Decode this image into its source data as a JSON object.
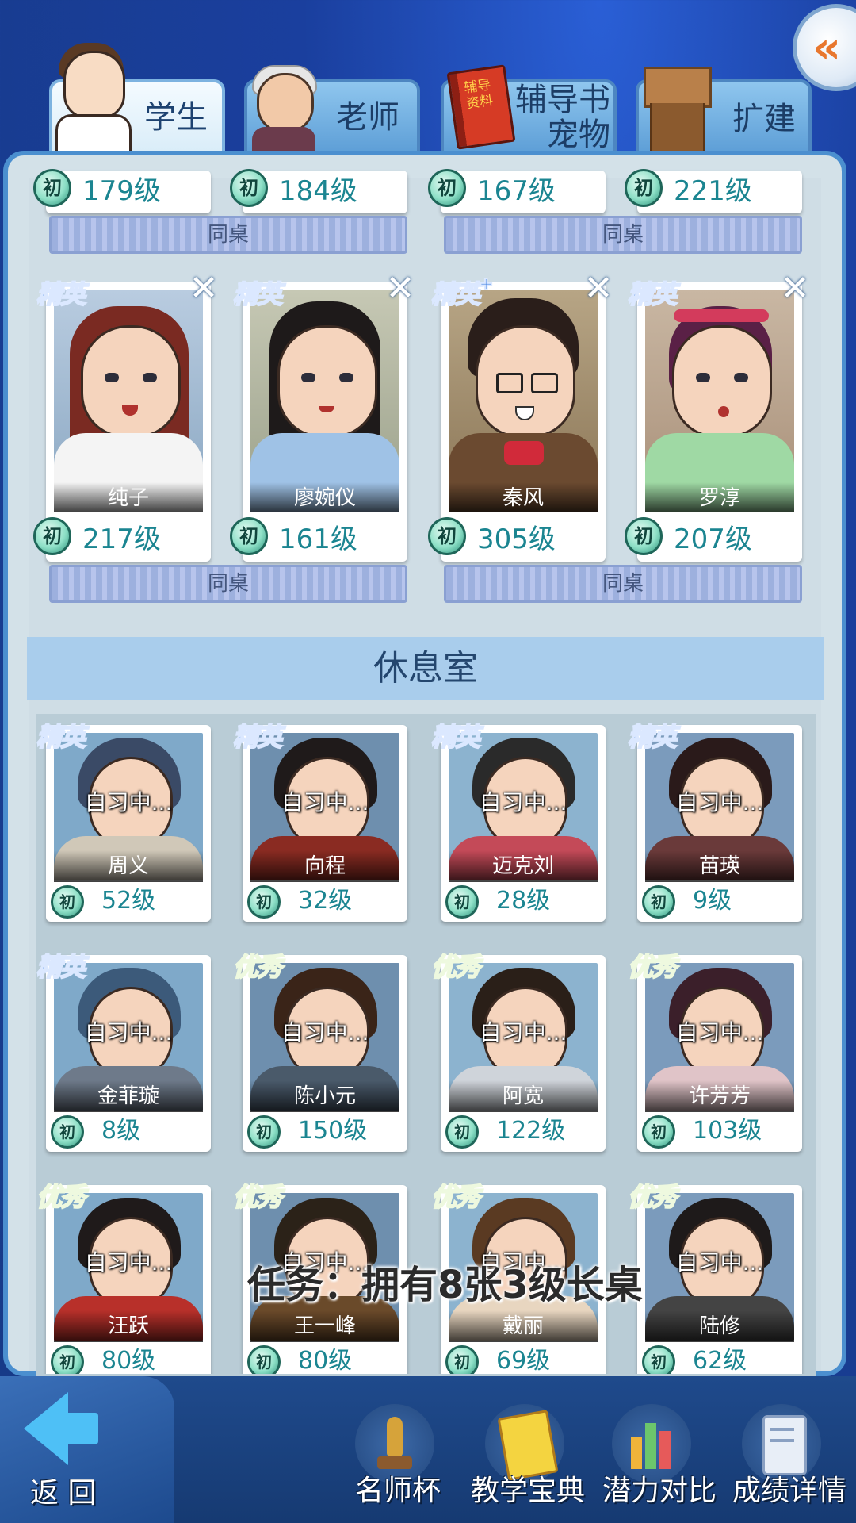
{
  "tabs": [
    {
      "label": "学生",
      "active": true
    },
    {
      "label": "老师",
      "active": false
    },
    {
      "label": "辅导书\n宠物",
      "active": false
    },
    {
      "label": "扩建",
      "active": false
    }
  ],
  "collapse_button": {
    "icon": "double-chevron-left-icon",
    "glyph": "«"
  },
  "book_cover_text": "辅导资料",
  "top_partial_row": [
    {
      "badge": "初",
      "level": "179级"
    },
    {
      "badge": "初",
      "level": "184级"
    },
    {
      "badge": "初",
      "level": "167级"
    },
    {
      "badge": "初",
      "level": "221级"
    }
  ],
  "deskmate_label": "同桌",
  "seat_row": [
    {
      "tag": "精英",
      "plus": false,
      "name": "纯子",
      "badge": "初",
      "level": "217级"
    },
    {
      "tag": "精英",
      "plus": false,
      "name": "廖婉仪",
      "badge": "初",
      "level": "161级"
    },
    {
      "tag": "精英",
      "plus": true,
      "name": "秦风",
      "badge": "初",
      "level": "305级"
    },
    {
      "tag": "精英",
      "plus": false,
      "name": "罗淳",
      "badge": "初",
      "level": "207级"
    }
  ],
  "close_glyph": "✕",
  "rest_room_title": "休息室",
  "studying_label": "自习中...",
  "rest_room": [
    {
      "tag": "精英",
      "name": "周义",
      "badge": "初",
      "level": "52级"
    },
    {
      "tag": "精英",
      "name": "向程",
      "badge": "初",
      "level": "32级"
    },
    {
      "tag": "精英",
      "name": "迈克刘",
      "badge": "初",
      "level": "28级"
    },
    {
      "tag": "精英",
      "name": "苗瑛",
      "badge": "初",
      "level": "9级"
    },
    {
      "tag": "精英",
      "name": "金菲璇",
      "badge": "初",
      "level": "8级"
    },
    {
      "tag": "优秀",
      "name": "陈小元",
      "badge": "初",
      "level": "150级"
    },
    {
      "tag": "优秀",
      "name": "阿宽",
      "badge": "初",
      "level": "122级"
    },
    {
      "tag": "优秀",
      "name": "许芳芳",
      "badge": "初",
      "level": "103级"
    },
    {
      "tag": "优秀",
      "name": "汪跃",
      "badge": "初",
      "level": "80级"
    },
    {
      "tag": "优秀",
      "name": "王一峰",
      "badge": "初",
      "level": "80级"
    },
    {
      "tag": "优秀",
      "name": "戴丽",
      "badge": "初",
      "level": "69级"
    },
    {
      "tag": "优秀",
      "name": "陆修",
      "badge": "初",
      "level": "62级"
    }
  ],
  "task_text": "任务：拥有8张3级长桌",
  "bottom_bar": {
    "back_label": "返 回",
    "items": [
      {
        "label": "名师杯",
        "icon": "trophy-icon"
      },
      {
        "label": "教学宝典",
        "icon": "book-icon"
      },
      {
        "label": "潜力对比",
        "icon": "bar-chart-icon"
      },
      {
        "label": "成绩详情",
        "icon": "report-card-icon"
      }
    ]
  },
  "colors": {
    "level_text": "#1b8591",
    "elite_tag": "#3f7fe0",
    "good_tag": "#79b93a",
    "panel_border": "#4b8fcf",
    "background": "#1a3f9e"
  }
}
